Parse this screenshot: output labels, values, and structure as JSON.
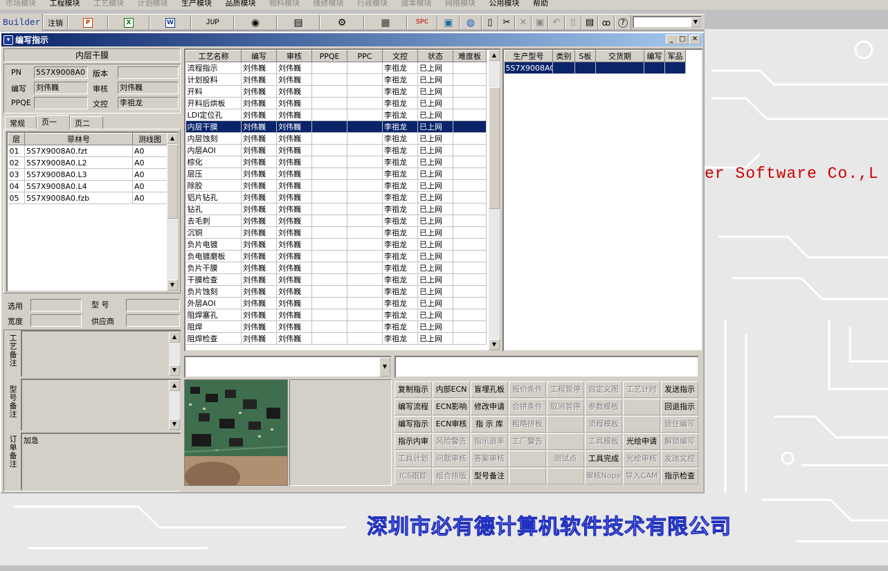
{
  "menubar": [
    "市场模块",
    "工程模块",
    "工艺模块",
    "计划模块",
    "生产模块",
    "品质模块",
    "物料模块",
    "维修模块",
    "行政模块",
    "成本模块",
    "网络模块",
    "公用模块",
    "帮助"
  ],
  "toolbar": {
    "builder": "Builder",
    "logout": "注销",
    "jup": "JUP",
    "spc": "SPC"
  },
  "company_en": "er Software Co.,L",
  "company_cn": "深圳市必有德计算机软件技术有限公司",
  "window": {
    "title": "编写指示"
  },
  "info": {
    "section_title": "内层干膜",
    "pn_label": "PN",
    "pn_value": "5S7X9008A0",
    "version_label": "版本",
    "version_value": "",
    "author_label": "编写",
    "author_value": "刘伟巍",
    "review_label": "审核",
    "review_value": "刘伟巍",
    "ppqe_label": "PPQE",
    "ppqe_value": "",
    "doc_label": "文控",
    "doc_value": "李祖龙"
  },
  "tabs": [
    "常规",
    "页一",
    "页二"
  ],
  "layers": {
    "headers": [
      "层",
      "菲林号",
      "测线图"
    ],
    "rows": [
      [
        "01",
        "5S7X9008A0.fzt",
        "A0"
      ],
      [
        "02",
        "5S7X9008A0.L2",
        "A0"
      ],
      [
        "03",
        "5S7X9008A0.L3",
        "A0"
      ],
      [
        "04",
        "5S7X9008A0.L4",
        "A0"
      ],
      [
        "05",
        "5S7X9008A0.fzb",
        "A0"
      ]
    ]
  },
  "material": {
    "select_label": "选用",
    "select_value": "",
    "model_label": "型  号",
    "model_value": "",
    "width_label": "宽度",
    "width_value": "",
    "supplier_label": "供应商",
    "supplier_value": ""
  },
  "notes": {
    "process_label": "工艺备注",
    "model_label": "型号备注",
    "order_label": "订单备注",
    "order_value": "加急"
  },
  "process": {
    "headers": [
      "工艺名称",
      "编写",
      "审核",
      "PPQE",
      "PPC",
      "文控",
      "状态",
      "难度板"
    ],
    "selected_index": 5,
    "rows": [
      [
        "流程指示",
        "刘伟巍",
        "刘伟巍",
        "",
        "",
        "李祖龙",
        "已上网",
        ""
      ],
      [
        "计划投料",
        "刘伟巍",
        "刘伟巍",
        "",
        "",
        "李祖龙",
        "已上网",
        ""
      ],
      [
        "开料",
        "刘伟巍",
        "刘伟巍",
        "",
        "",
        "李祖龙",
        "已上网",
        ""
      ],
      [
        "开料后烘板",
        "刘伟巍",
        "刘伟巍",
        "",
        "",
        "李祖龙",
        "已上网",
        ""
      ],
      [
        "LDI定位孔",
        "刘伟巍",
        "刘伟巍",
        "",
        "",
        "李祖龙",
        "已上网",
        ""
      ],
      [
        "内层干膜",
        "刘伟巍",
        "刘伟巍",
        "",
        "",
        "李祖龙",
        "已上网",
        ""
      ],
      [
        "内层蚀刻",
        "刘伟巍",
        "刘伟巍",
        "",
        "",
        "李祖龙",
        "已上网",
        ""
      ],
      [
        "内层AOI",
        "刘伟巍",
        "刘伟巍",
        "",
        "",
        "李祖龙",
        "已上网",
        ""
      ],
      [
        "棕化",
        "刘伟巍",
        "刘伟巍",
        "",
        "",
        "李祖龙",
        "已上网",
        ""
      ],
      [
        "层压",
        "刘伟巍",
        "刘伟巍",
        "",
        "",
        "李祖龙",
        "已上网",
        ""
      ],
      [
        "除胶",
        "刘伟巍",
        "刘伟巍",
        "",
        "",
        "李祖龙",
        "已上网",
        ""
      ],
      [
        "铝片钻孔",
        "刘伟巍",
        "刘伟巍",
        "",
        "",
        "李祖龙",
        "已上网",
        ""
      ],
      [
        "钻孔",
        "刘伟巍",
        "刘伟巍",
        "",
        "",
        "李祖龙",
        "已上网",
        ""
      ],
      [
        "去毛刺",
        "刘伟巍",
        "刘伟巍",
        "",
        "",
        "李祖龙",
        "已上网",
        ""
      ],
      [
        "沉铜",
        "刘伟巍",
        "刘伟巍",
        "",
        "",
        "李祖龙",
        "已上网",
        ""
      ],
      [
        "负片电镀",
        "刘伟巍",
        "刘伟巍",
        "",
        "",
        "李祖龙",
        "已上网",
        ""
      ],
      [
        "负电镀磨板",
        "刘伟巍",
        "刘伟巍",
        "",
        "",
        "李祖龙",
        "已上网",
        ""
      ],
      [
        "负片干膜",
        "刘伟巍",
        "刘伟巍",
        "",
        "",
        "李祖龙",
        "已上网",
        ""
      ],
      [
        "干膜检查",
        "刘伟巍",
        "刘伟巍",
        "",
        "",
        "李祖龙",
        "已上网",
        ""
      ],
      [
        "负片蚀刻",
        "刘伟巍",
        "刘伟巍",
        "",
        "",
        "李祖龙",
        "已上网",
        ""
      ],
      [
        "外层AOI",
        "刘伟巍",
        "刘伟巍",
        "",
        "",
        "李祖龙",
        "已上网",
        ""
      ],
      [
        "阻焊塞孔",
        "刘伟巍",
        "刘伟巍",
        "",
        "",
        "李祖龙",
        "已上网",
        ""
      ],
      [
        "阻焊",
        "刘伟巍",
        "刘伟巍",
        "",
        "",
        "李祖龙",
        "已上网",
        ""
      ],
      [
        "阻焊检查",
        "刘伟巍",
        "刘伟巍",
        "",
        "",
        "李祖龙",
        "已上网",
        ""
      ]
    ]
  },
  "production": {
    "headers": [
      "生产型号",
      "类别",
      "S板",
      "交货期",
      "编写",
      "军品"
    ],
    "rows": [
      [
        "5S7X9008A0",
        "",
        "",
        "",
        "",
        ""
      ]
    ]
  },
  "actions": {
    "rows": [
      [
        [
          "复制指示",
          1
        ],
        [
          "内部ECN",
          1
        ],
        [
          "盲埋孔板",
          1
        ],
        [
          "报价条件",
          0
        ],
        [
          "工程暂停",
          0
        ],
        [
          "自定义图",
          0
        ],
        [
          "工艺计时",
          0
        ],
        [
          "发送指示",
          1
        ]
      ],
      [
        [
          "编写流程",
          1
        ],
        [
          "ECN影响",
          1
        ],
        [
          "修改申请",
          1
        ],
        [
          "合拼条件",
          0
        ],
        [
          "取消暂停",
          0
        ],
        [
          "参数模板",
          0
        ],
        [
          "",
          0
        ],
        [
          "回退指示",
          1
        ]
      ],
      [
        [
          "编写指示",
          1
        ],
        [
          "ECN审核",
          1
        ],
        [
          "指 示 库",
          1
        ],
        [
          "粗略拼板",
          0
        ],
        [
          "",
          0
        ],
        [
          "流程模板",
          0
        ],
        [
          "",
          0
        ],
        [
          "锁住编写",
          0
        ]
      ],
      [
        [
          "指示内审",
          1
        ],
        [
          "风险警告",
          0
        ],
        [
          "指示退率",
          0
        ],
        [
          "工厂警告",
          0
        ],
        [
          "",
          0
        ],
        [
          "工具模板",
          0
        ],
        [
          "光绘申请",
          1
        ],
        [
          "解锁编写",
          0
        ]
      ],
      [
        [
          "工具计划",
          0
        ],
        [
          "问题审核",
          0
        ],
        [
          "答案审核",
          0
        ],
        [
          "",
          0
        ],
        [
          "测试点",
          0
        ],
        [
          "工具完成",
          1
        ],
        [
          "光绘审核",
          0
        ],
        [
          "发送文控",
          0
        ]
      ],
      [
        [
          "ICS跟踪",
          0
        ],
        [
          "组合排版",
          0
        ],
        [
          "型号备注",
          1
        ],
        [
          "",
          0
        ],
        [
          "",
          0
        ],
        [
          "审核Nope",
          0
        ],
        [
          "导入CAM",
          0
        ],
        [
          "指示检查",
          1
        ]
      ]
    ]
  }
}
